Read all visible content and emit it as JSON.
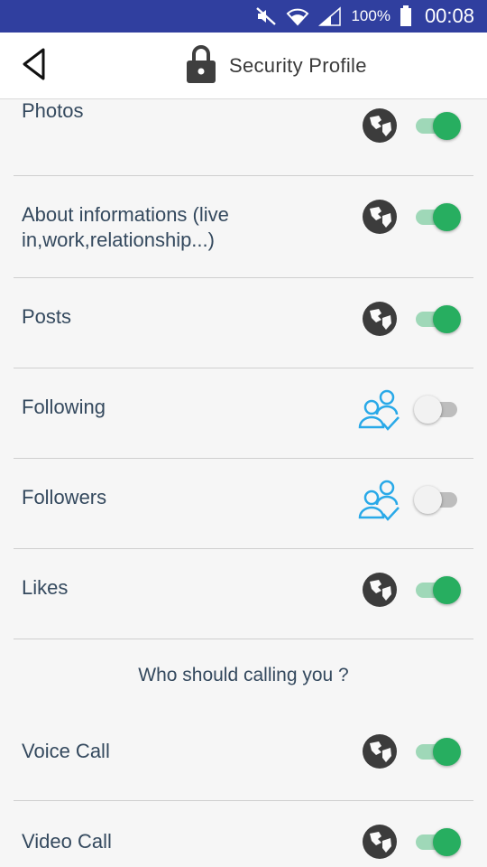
{
  "status_bar": {
    "battery": "100%",
    "time": "00:08",
    "icons": [
      "mute-icon",
      "wifi-icon",
      "signal-icon",
      "battery-icon"
    ]
  },
  "header": {
    "back_icon": "back-icon",
    "lock_icon": "lock-icon",
    "title": "Security Profile"
  },
  "rows": [
    {
      "label": "Photos",
      "icon": "globe-icon",
      "toggle": "on"
    },
    {
      "label": "About informations (live in,work,relationship...)",
      "icon": "globe-icon",
      "toggle": "on"
    },
    {
      "label": "Posts",
      "icon": "globe-icon",
      "toggle": "on"
    },
    {
      "label": "Following",
      "icon": "friends-icon",
      "toggle": "off"
    },
    {
      "label": "Followers",
      "icon": "friends-icon",
      "toggle": "off"
    },
    {
      "label": "Likes",
      "icon": "globe-icon",
      "toggle": "on"
    }
  ],
  "calls_section": {
    "heading": "Who should calling you ?",
    "rows": [
      {
        "label": "Voice Call",
        "icon": "globe-icon",
        "toggle": "on"
      },
      {
        "label": "Video Call",
        "icon": "globe-icon",
        "toggle": "on"
      }
    ]
  },
  "colors": {
    "status_bar": "#303f9f",
    "toggle_on": "#27ae60",
    "friends_icon": "#29a9e8",
    "globe_icon": "#3c3c3c",
    "label_text": "#34495e"
  }
}
